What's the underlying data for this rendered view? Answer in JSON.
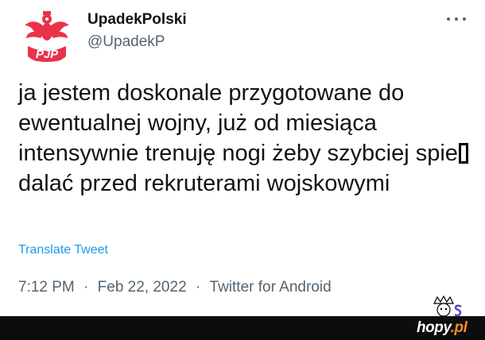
{
  "author": {
    "display_name": "UpadekPolski",
    "handle": "@UpadekP",
    "avatar_text": "PJP",
    "avatar_icon": "eagle-emblem-icon"
  },
  "more_icon": "more-horizontal-icon",
  "tweet": {
    "text_part1": "ja jestem doskonale przygotowane do ewentualnej wojny, już od miesiąca intensywnie trenuję nogi żeby szybciej spie",
    "text_part2": "dalać przed rekruterami wojskowymi"
  },
  "translate_label": "Translate Tweet",
  "meta": {
    "time": "7:12 PM",
    "separator": "·",
    "date": "Feb 22, 2022",
    "source": "Twitter for Android"
  },
  "watermark": {
    "text_main": "hopy",
    "text_suffix": ".pl"
  },
  "colors": {
    "link": "#1d9bf0",
    "secondary_text": "#536471",
    "primary_text": "#0f1419",
    "avatar_accent": "#e8334a",
    "footer": "#0d0d0d"
  }
}
